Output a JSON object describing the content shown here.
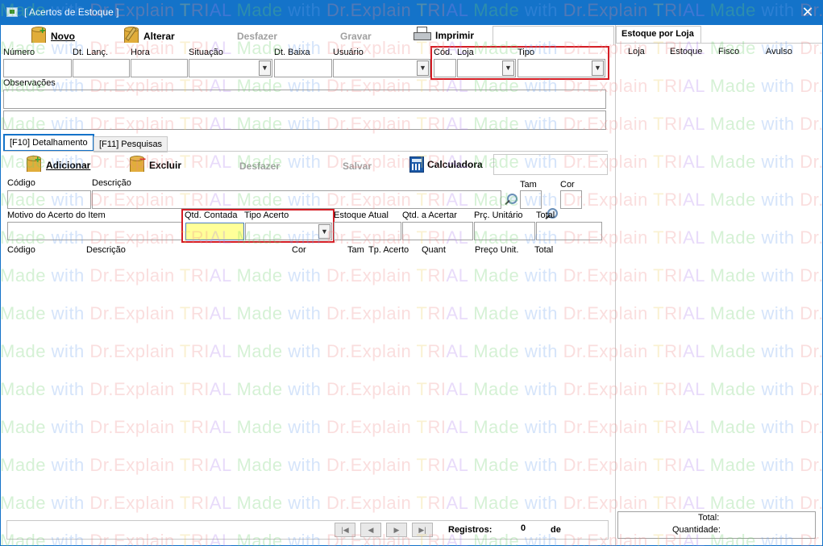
{
  "window": {
    "title": "[ Acertos de Estoque ]",
    "close_glyph": "✕"
  },
  "toolbar": {
    "novo": "Novo",
    "alterar": "Alterar",
    "desfazer": "Desfazer",
    "gravar": "Gravar",
    "imprimir": "Imprimir"
  },
  "header_fields": {
    "numero": "Número",
    "dt_lanc": "Dt. Lanç.",
    "hora": "Hora",
    "situacao": "Situação",
    "dt_baixa": "Dt. Baixa",
    "usuario": "Usuário",
    "cod": "Cód.",
    "loja": "Loja",
    "tipo": "Tipo",
    "observacoes": "Observações"
  },
  "tabs": {
    "detalhamento": "[F10] Detalhamento",
    "pesquisas": "[F11] Pesquisas"
  },
  "detail_toolbar": {
    "adicionar": "Adicionar",
    "excluir": "Excluir",
    "desfazer": "Desfazer",
    "salvar": "Salvar",
    "calculadora": "Calculadora"
  },
  "detail_fields": {
    "codigo": "Código",
    "descricao": "Descrição",
    "tam": "Tam",
    "cor": "Cor",
    "motivo": "Motivo do Acerto do Item",
    "qtd_contada": "Qtd. Contada",
    "tipo_acerto": "Tipo Acerto",
    "estoque_atual": "Estoque Atual",
    "qtd_acertar": "Qtd. a Acertar",
    "prc_unitario": "Prç. Unitário",
    "total": "Total"
  },
  "grid_headers": [
    "Código",
    "Descrição",
    "Cor",
    "Tam",
    "Tp. Acerto",
    "Quant",
    "Preço Unit.",
    "Total"
  ],
  "stock_panel": {
    "tab_label": "Estoque por Loja",
    "headers": [
      "Loja",
      "Estoque",
      "Fisco",
      "Avulso"
    ],
    "total_label": "Total:",
    "quantidade_label": "Quantidade:"
  },
  "footer": {
    "registros_label": "Registros:",
    "registros_value": "0",
    "de_label": "de"
  },
  "watermark": {
    "part1": "Made",
    "part2": "with",
    "part3": "Dr.Explain",
    "part4": "T",
    "part5": "RI",
    "part6": "AL"
  },
  "colors": {
    "title_bar": "#1473c9",
    "highlight_red": "#d41c24",
    "qtd_field": "#ffff99",
    "active_tab_border": "#1473c9"
  }
}
